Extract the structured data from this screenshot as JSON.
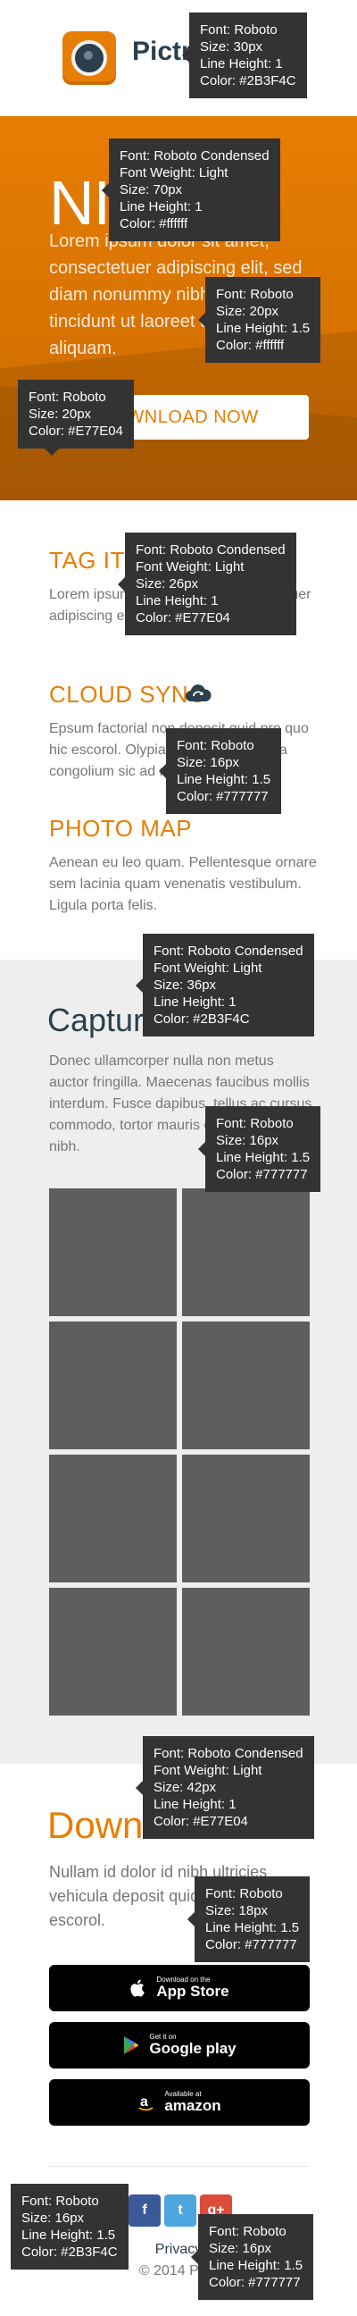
{
  "header": {
    "brand": "Pictr",
    "logo_icon": "camera-lens-icon"
  },
  "hero": {
    "title": "NICE",
    "text": "Lorem ipsum dolor sit amet, consectetuer adipiscing elit, sed diam nonummy nibh euismod tincidunt ut laoreet dolore magna aliquam.",
    "button_label": "DOWNLOAD NOW"
  },
  "features": [
    {
      "title": "TAG IT",
      "text": "Lorem ipsum dolor sit amet, consectetuer adipiscing elit, sed suscipit aliquam."
    },
    {
      "title": "CLOUD SYNC",
      "text": "Epsum factorial non deposit quid pro quo hic escorol. Olypian quarrels et gorilla congolium sic ad nauseum."
    },
    {
      "title": "PHOTO MAP",
      "text": "Aenean eu leo quam. Pellentesque ornare sem lacinia quam venenatis vestibulum. Ligula porta felis."
    }
  ],
  "capture": {
    "title": "Capture",
    "text": "Donec ullamcorper nulla non metus auctor fringilla. Maecenas faucibus mollis interdum. Fusce dapibus, tellus ac cursus commodo, tortor mauris condimentum nibh."
  },
  "download": {
    "title": "Download",
    "text": "Nullam id dolor id nibh ultricies vehicula deposit quid pro quo hic escorol.",
    "stores": [
      {
        "small": "Download on the",
        "big": "App Store",
        "icon": "apple-icon"
      },
      {
        "small": "Get it on",
        "big": "Google play",
        "icon": "google-play-icon"
      },
      {
        "small": "Available at",
        "big": "amazon",
        "icon": "amazon-icon"
      }
    ]
  },
  "footer": {
    "links": "Privacy",
    "copyright": "© 2014 Pictr",
    "social": [
      {
        "icon": "facebook-icon",
        "glyph": "f"
      },
      {
        "icon": "twitter-icon",
        "glyph": "t"
      },
      {
        "icon": "google-plus-icon",
        "glyph": "g+"
      }
    ]
  },
  "annotations": [
    {
      "lines": [
        "Font: Roboto",
        "Size: 30px",
        "Line Height: 1",
        "Color: #2B3F4C"
      ]
    },
    {
      "lines": [
        "Font: Roboto Condensed",
        "Font Weight: Light",
        "Size: 70px",
        "Line Height: 1",
        "Color: #ffffff"
      ]
    },
    {
      "lines": [
        "Font: Roboto",
        "Size: 20px",
        "Line Height: 1.5",
        "Color: #ffffff"
      ]
    },
    {
      "lines": [
        "Font: Roboto",
        "Size: 20px",
        "Color: #E77E04"
      ]
    },
    {
      "lines": [
        "Font: Roboto Condensed",
        "Font Weight: Light",
        "Size: 26px",
        "Line Height: 1",
        "Color: #E77E04"
      ]
    },
    {
      "lines": [
        "Font: Roboto",
        "Size: 16px",
        "Line Height: 1.5",
        "Color: #777777"
      ]
    },
    {
      "lines": [
        "Font: Roboto Condensed",
        "Font Weight: Light",
        "Size: 36px",
        "Line Height: 1",
        "Color: #2B3F4C"
      ]
    },
    {
      "lines": [
        "Font: Roboto",
        "Size: 16px",
        "Line Height: 1.5",
        "Color: #777777"
      ]
    },
    {
      "lines": [
        "Font: Roboto Condensed",
        "Font Weight: Light",
        "Size: 42px",
        "Line Height: 1",
        "Color: #E77E04"
      ]
    },
    {
      "lines": [
        "Font: Roboto",
        "Size: 18px",
        "Line Height: 1.5",
        "Color: #777777"
      ]
    },
    {
      "lines": [
        "Font: Roboto",
        "Size: 16px",
        "Line Height: 1.5",
        "Color: #2B3F4C"
      ]
    },
    {
      "lines": [
        "Font: Roboto",
        "Size: 16px",
        "Line Height: 1.5",
        "Color: #777777"
      ]
    }
  ],
  "colors": {
    "accent": "#E77E04",
    "dark": "#2B3F4C",
    "body": "#777777",
    "tile": "#5e5e5e"
  }
}
